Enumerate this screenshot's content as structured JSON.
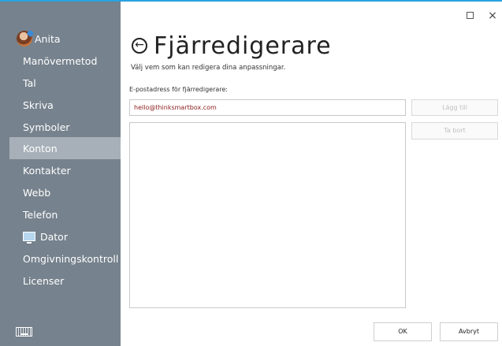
{
  "sidebar": {
    "user_name": "Anita",
    "items": [
      {
        "label": "Manövermetod"
      },
      {
        "label": "Tal"
      },
      {
        "label": "Skriva"
      },
      {
        "label": "Symboler"
      },
      {
        "label": "Konton",
        "selected": true
      },
      {
        "label": "Kontakter"
      },
      {
        "label": "Webb"
      },
      {
        "label": "Telefon"
      },
      {
        "label": "Dator",
        "icon": "monitor-icon"
      },
      {
        "label": "Omgivningskontroll"
      },
      {
        "label": "Licenser"
      }
    ],
    "footer_icon": "keyboard-icon"
  },
  "window": {
    "maximize_icon": "maximize-icon",
    "close_glyph": "×"
  },
  "page": {
    "title": "Fjärredigerare",
    "back_icon": "back-arrow-icon",
    "subtitle": "Välj vem som kan redigera dina anpassningar.",
    "field_label": "E-postadress för fjärredigerare:",
    "email_value": "hello@thinksmartbox.com",
    "add_button": "Lägg till",
    "remove_button": "Ta bort",
    "ok_button": "OK",
    "cancel_button": "Avbryt"
  },
  "colors": {
    "sidebar_bg": "#76828d",
    "sidebar_selected": "#a7b0b8",
    "accent_topline": "#29a3e0",
    "email_text": "#8a1c1c"
  }
}
